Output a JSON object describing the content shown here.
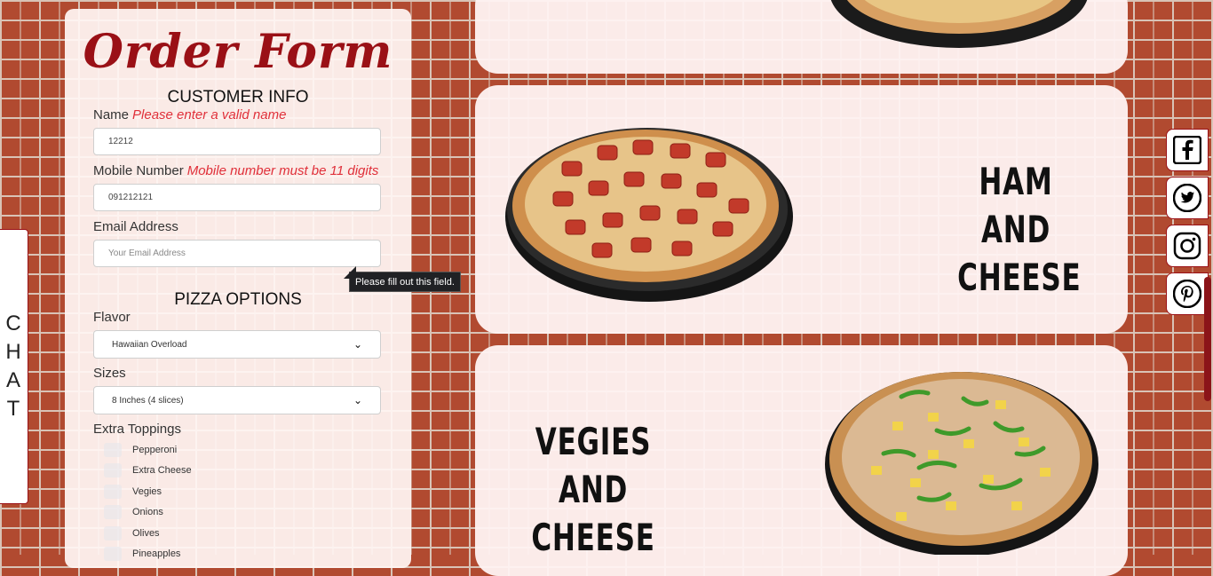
{
  "form": {
    "title": "Order Form",
    "customer_heading": "CUSTOMER INFO",
    "name_label": "Name",
    "name_error": "Please enter a valid name",
    "name_value": "12212",
    "mobile_label": "Mobile Number",
    "mobile_error": "Mobile number must be 11 digits",
    "mobile_value": "091212121",
    "email_label": "Email Address",
    "email_placeholder": "Your Email Address",
    "tooltip": "Please fill out this field.",
    "pizza_heading": "PIZZA OPTIONS",
    "flavor_label": "Flavor",
    "flavor_value": "Hawaiian Overload",
    "sizes_label": "Sizes",
    "sizes_value": "8 Inches (4 slices)",
    "toppings_label": "Extra Toppings",
    "toppings": [
      "Pepperoni",
      "Extra Cheese",
      "Vegies",
      "Onions",
      "Olives",
      "Pineapples"
    ]
  },
  "chat": {
    "label": "CHAT"
  },
  "cards": [
    {
      "title": ""
    },
    {
      "title_line1": "HAM AND",
      "title_line2": "CHEESE"
    },
    {
      "title_line1": "VEGIES AND",
      "title_line2": "CHEESE"
    }
  ],
  "social": [
    "facebook-icon",
    "twitter-icon",
    "instagram-icon",
    "pinterest-icon"
  ],
  "colors": {
    "brand": "#9a1016",
    "error": "#e0303a"
  }
}
